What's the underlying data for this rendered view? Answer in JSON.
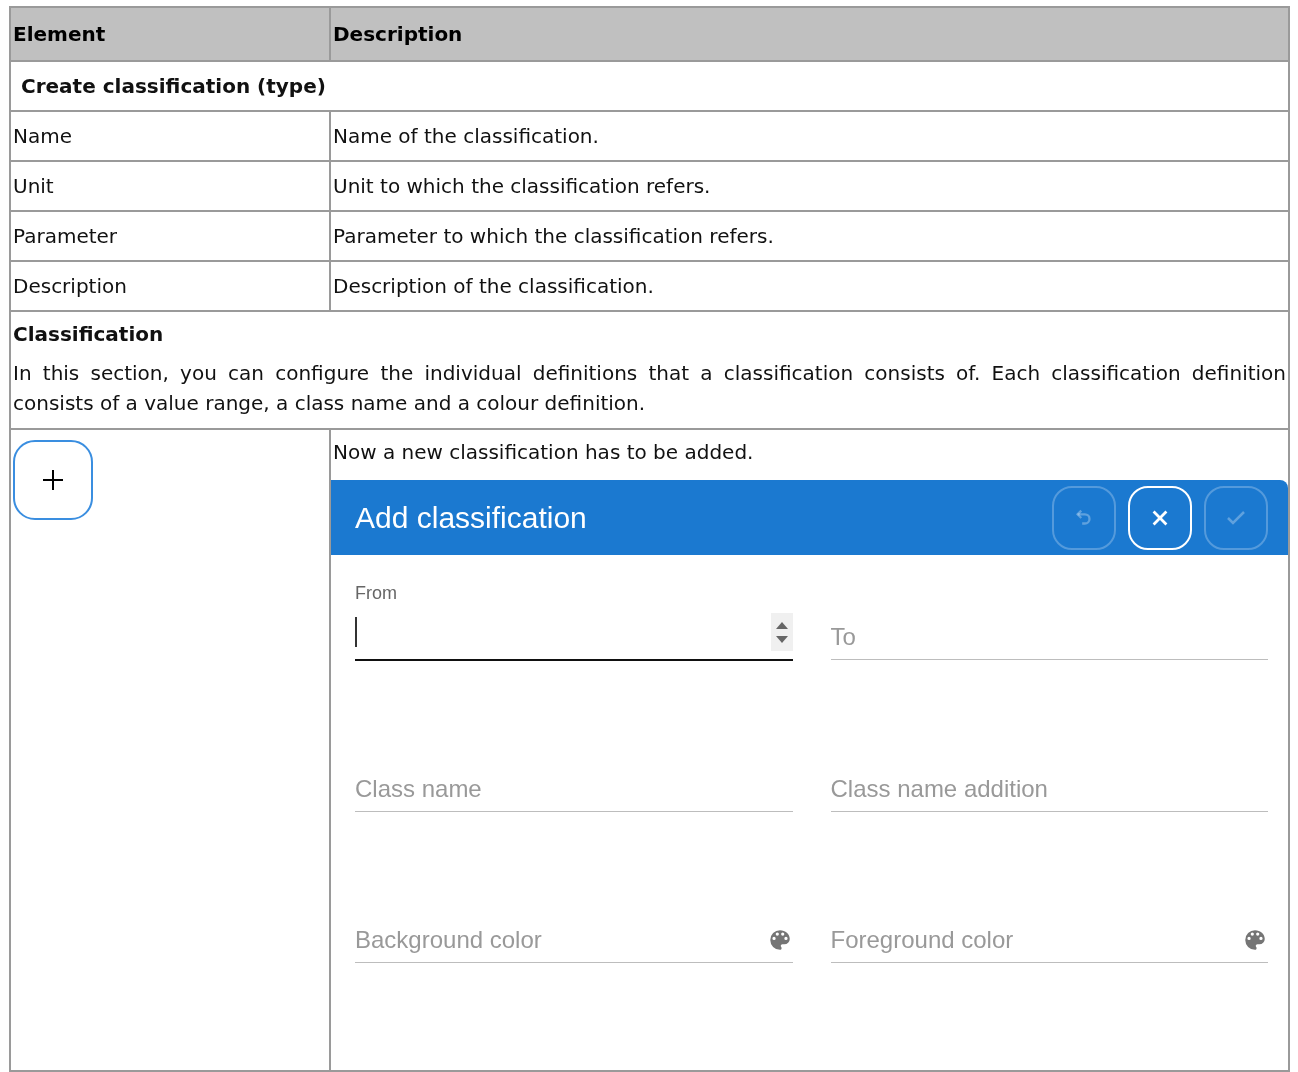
{
  "table": {
    "columns": [
      "Element",
      "Description"
    ],
    "rows": [
      {
        "kind": "heading",
        "text": "Create classification (type)"
      },
      {
        "kind": "pair",
        "element": "Name",
        "description": "Name of the classification."
      },
      {
        "kind": "pair",
        "element": "Unit",
        "description": "Unit to which the classification refers."
      },
      {
        "kind": "pair",
        "element": "Parameter",
        "description": "Parameter to which the classification refers."
      },
      {
        "kind": "pair",
        "element": "Description",
        "description": "Description of the classification."
      },
      {
        "kind": "section",
        "title": "Classification",
        "text": "In this section, you can configure the individual definitions that a classification consists of. Each classification definition consists of a value range, a class name and a colour definition."
      },
      {
        "kind": "dialog",
        "description": "Now a new classification has to be added.",
        "dialog": {
          "title": "Add classification",
          "buttons": [
            {
              "kind": "undo",
              "disabled": true
            },
            {
              "kind": "close",
              "disabled": false
            },
            {
              "kind": "confirm",
              "disabled": true
            }
          ],
          "fields": [
            {
              "kind": "number",
              "label": "From",
              "focused": true
            },
            {
              "kind": "number",
              "label": "To",
              "focused": false
            },
            {
              "kind": "text",
              "label": "Class name",
              "focused": false
            },
            {
              "kind": "text",
              "label": "Class name addition",
              "focused": false
            },
            {
              "kind": "color",
              "label": "Background color",
              "focused": false
            },
            {
              "kind": "color",
              "label": "Foreground color",
              "focused": false
            }
          ]
        }
      }
    ]
  }
}
